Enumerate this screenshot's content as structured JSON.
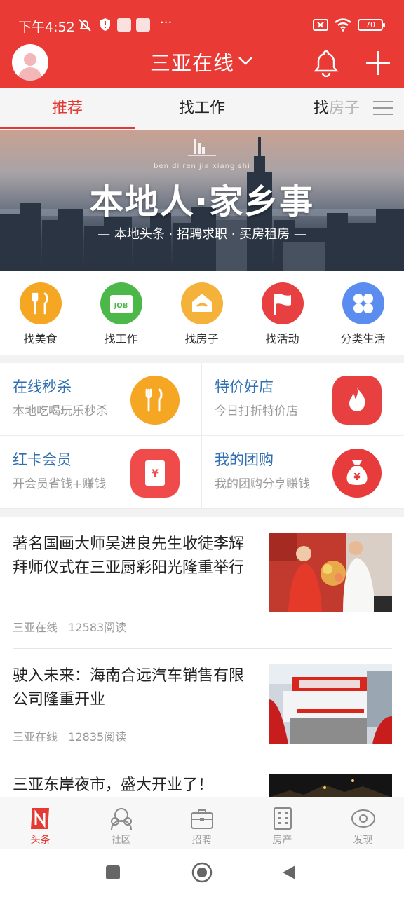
{
  "status_bar": {
    "time": "下午4:52",
    "more": "···",
    "battery": "70"
  },
  "header": {
    "city": "三亚在线"
  },
  "tabs": [
    {
      "label": "推荐"
    },
    {
      "label": "找工作"
    },
    {
      "label_a": "找",
      "label_b": "房子"
    }
  ],
  "banner": {
    "pinyin": "ben di ren jia xiang shi",
    "title": "本地人·家乡事",
    "subtitle": "— 本地头条 · 招聘求职 · 买房租房 —"
  },
  "categories": [
    {
      "label": "找美食",
      "icon": "fork-knife-icon",
      "color": "#f5a623"
    },
    {
      "label": "找工作",
      "icon": "job-board-icon",
      "color": "#4cb84a",
      "badge": "JOB"
    },
    {
      "label": "找房子",
      "icon": "house-icon",
      "color": "#f4b23b"
    },
    {
      "label": "找活动",
      "icon": "flag-icon",
      "color": "#e84040"
    },
    {
      "label": "分类生活",
      "icon": "grid-clover-icon",
      "color": "#5b8df0"
    }
  ],
  "promos": [
    {
      "title": "在线秒杀",
      "subtitle": "本地吃喝玩乐秒杀",
      "icon": "fork-knife-icon",
      "color": "#f5a623"
    },
    {
      "title": "特价好店",
      "subtitle": "今日打折特价店",
      "icon": "flame-icon",
      "color": "#e84040"
    },
    {
      "title": "红卡会员",
      "subtitle": "开会员省钱+赚钱",
      "icon": "red-envelope-icon",
      "color": "#ef4b4b",
      "symbol": "¥"
    },
    {
      "title": "我的团购",
      "subtitle": "我的团购分享赚钱",
      "icon": "money-bag-icon",
      "color": "#e83b3b",
      "symbol": "¥"
    }
  ],
  "news": [
    {
      "title": "著名国画大师吴进良先生收徒李辉拜师仪式在三亚厨彩阳光隆重举行",
      "source": "三亚在线",
      "reads": "12583阅读"
    },
    {
      "title": "驶入未来：海南合远汽车销售有限公司隆重开业",
      "source": "三亚在线",
      "reads": "12835阅读"
    },
    {
      "title": "三亚东岸夜市，盛大开业了！",
      "source": "",
      "reads": ""
    }
  ],
  "bottom_nav": [
    {
      "label": "头条",
      "icon": "headline-n-icon",
      "active": true
    },
    {
      "label": "社区",
      "icon": "community-icon",
      "active": false
    },
    {
      "label": "招聘",
      "icon": "briefcase-icon",
      "active": false
    },
    {
      "label": "房产",
      "icon": "building-icon",
      "active": false
    },
    {
      "label": "发现",
      "icon": "eye-icon",
      "active": false
    }
  ],
  "colors": {
    "brand_red": "#ea3a36",
    "tab_active": "#e23a33",
    "promo_title": "#2f6fb2"
  }
}
